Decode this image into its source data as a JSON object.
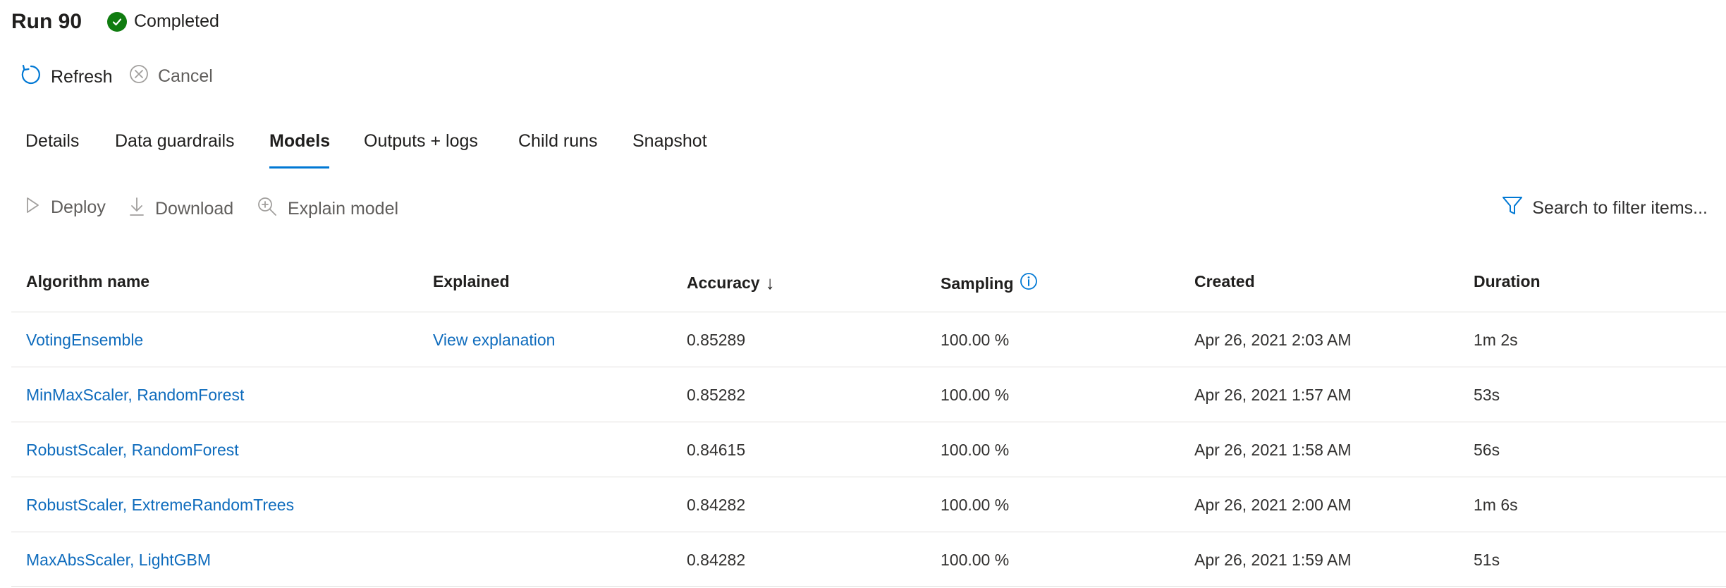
{
  "header": {
    "title": "Run 90",
    "status": "Completed"
  },
  "commands": {
    "refresh": "Refresh",
    "cancel": "Cancel"
  },
  "tabs": [
    {
      "label": "Details"
    },
    {
      "label": "Data guardrails"
    },
    {
      "label": "Models",
      "active": true
    },
    {
      "label": "Outputs + logs"
    },
    {
      "label": "Child runs"
    },
    {
      "label": "Snapshot"
    }
  ],
  "toolbar": {
    "deploy": "Deploy",
    "download": "Download",
    "explain": "Explain model",
    "search_placeholder": "Search to filter items..."
  },
  "table": {
    "headers": {
      "algorithm": "Algorithm name",
      "explained": "Explained",
      "accuracy": "Accuracy",
      "sampling": "Sampling",
      "created": "Created",
      "duration": "Duration"
    },
    "sort_indicator": "↓",
    "rows": [
      {
        "algorithm": "VotingEnsemble",
        "explained": "View explanation",
        "accuracy": "0.85289",
        "sampling": "100.00 %",
        "created": "Apr 26, 2021 2:03 AM",
        "duration": "1m 2s"
      },
      {
        "algorithm": "MinMaxScaler, RandomForest",
        "explained": "",
        "accuracy": "0.85282",
        "sampling": "100.00 %",
        "created": "Apr 26, 2021 1:57 AM",
        "duration": "53s"
      },
      {
        "algorithm": "RobustScaler, RandomForest",
        "explained": "",
        "accuracy": "0.84615",
        "sampling": "100.00 %",
        "created": "Apr 26, 2021 1:58 AM",
        "duration": "56s"
      },
      {
        "algorithm": "RobustScaler, ExtremeRandomTrees",
        "explained": "",
        "accuracy": "0.84282",
        "sampling": "100.00 %",
        "created": "Apr 26, 2021 2:00 AM",
        "duration": "1m 6s"
      },
      {
        "algorithm": "MaxAbsScaler, LightGBM",
        "explained": "",
        "accuracy": "0.84282",
        "sampling": "100.00 %",
        "created": "Apr 26, 2021 1:59 AM",
        "duration": "51s"
      }
    ]
  },
  "colors": {
    "accent": "#0078d4",
    "link": "#0f6cbd",
    "success": "#107c10"
  },
  "icons": {
    "status": "check-circle-icon",
    "refresh": "refresh-icon",
    "cancel": "cancel-icon",
    "deploy": "play-icon",
    "download": "download-icon",
    "explain": "zoom-icon",
    "filter": "filter-icon",
    "info": "info-icon"
  }
}
